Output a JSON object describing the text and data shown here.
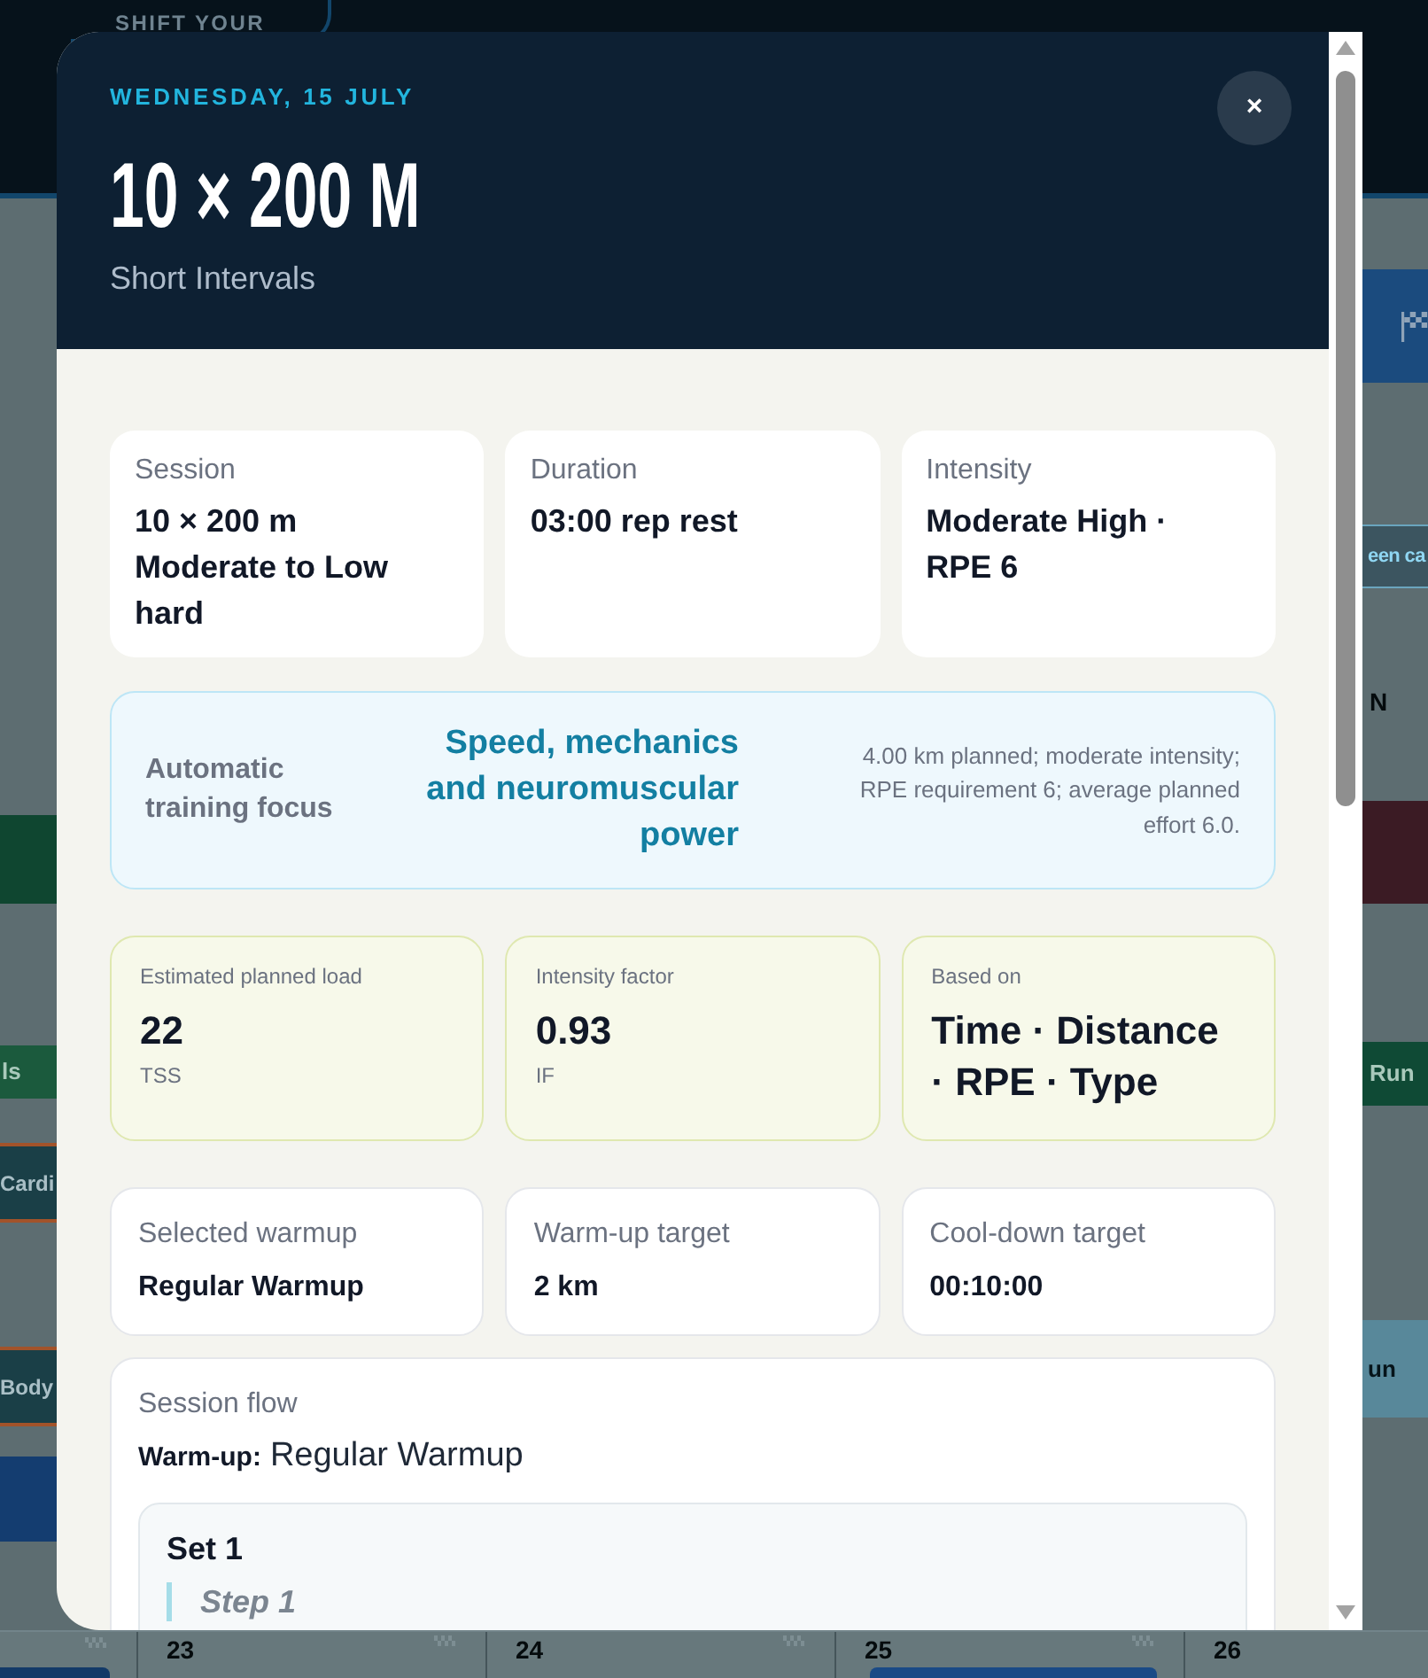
{
  "background": {
    "banner_text": "SHIFT YOUR",
    "left_entries": [
      {
        "kind": "chip",
        "color": "#0f4630"
      },
      {
        "kind": "chip",
        "label": "ls",
        "color": "#1b5a3d"
      },
      {
        "kind": "bordered",
        "label": "Cardi",
        "color": "#1a3f47"
      },
      {
        "kind": "bordered",
        "label": "Body",
        "color": "#1a3f47"
      },
      {
        "kind": "chip",
        "color": "#143d70"
      }
    ],
    "right_entries": [
      {
        "kind": "flag",
        "color": "#1b4b7e"
      },
      {
        "kind": "light",
        "label": "een ca",
        "color": "#3c5560"
      },
      {
        "kind": "text",
        "label": "N"
      },
      {
        "kind": "chip",
        "color": "#3b1b24"
      },
      {
        "kind": "chip",
        "label": "Run",
        "color": "#0f4a35"
      },
      {
        "kind": "pale",
        "label": "un",
        "color": "#58889a"
      }
    ],
    "day_numbers": [
      "23",
      "24",
      "25",
      "26"
    ]
  },
  "modal": {
    "date": "WEDNESDAY, 15 JULY",
    "title": "10 × 200 M",
    "subtitle": "Short Intervals",
    "close_label": "×",
    "summary_cards": [
      {
        "label": "Session",
        "value": "10 × 200 m Moderate to Low hard"
      },
      {
        "label": "Duration",
        "value": "03:00 rep rest"
      },
      {
        "label": "Intensity",
        "value": "Moderate High · RPE 6"
      }
    ],
    "focus": {
      "label": "Automatic training focus",
      "title": "Speed, mechanics and neuromuscular power",
      "details": "4.00 km planned; moderate intensity; RPE requirement 6; average planned effort 6.0."
    },
    "load_cards": [
      {
        "label": "Estimated planned load",
        "value": "22",
        "unit": "TSS"
      },
      {
        "label": "Intensity factor",
        "value": "0.93",
        "unit": "IF"
      },
      {
        "label": "Based on",
        "value": "Time · Distance · RPE · Type"
      }
    ],
    "warmup_cards": [
      {
        "label": "Selected warmup",
        "value": "Regular Warmup"
      },
      {
        "label": "Warm-up target",
        "value": "2 km"
      },
      {
        "label": "Cool-down target",
        "value": "00:10:00"
      }
    ],
    "session_flow": {
      "title": "Session flow",
      "warmup_label": "Warm-up:",
      "warmup_value": "Regular Warmup",
      "sets": [
        {
          "title": "Set 1",
          "steps": [
            {
              "title": "Step 1"
            }
          ]
        }
      ]
    }
  }
}
